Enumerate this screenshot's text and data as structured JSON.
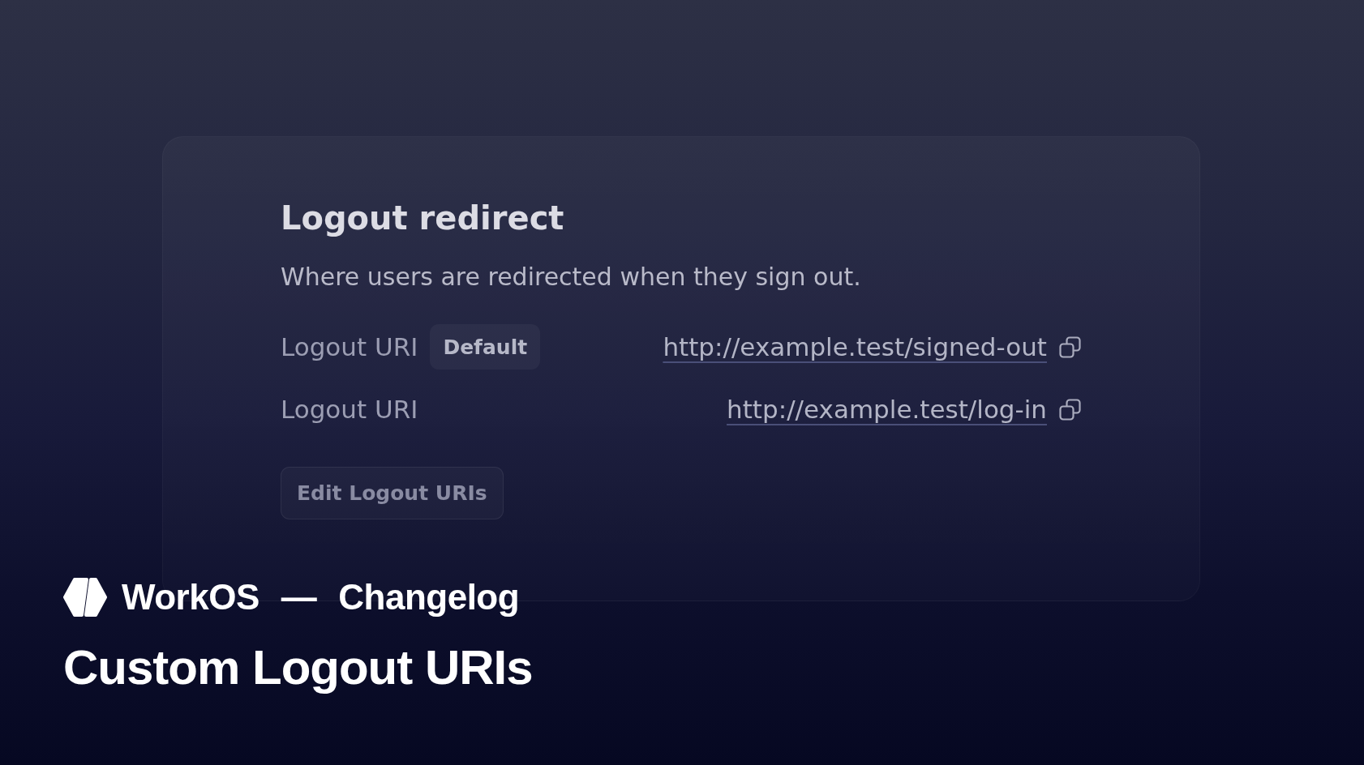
{
  "card": {
    "title": "Logout redirect",
    "description": "Where users are redirected when they sign out.",
    "uris": [
      {
        "label": "Logout URI",
        "badge": "Default",
        "url": "http://example.test/signed-out"
      },
      {
        "label": "Logout URI",
        "url": "http://example.test/log-in"
      }
    ],
    "button": "Edit Logout URIs"
  },
  "footer": {
    "brand": "WorkOS",
    "separator": "—",
    "section": "Changelog",
    "headline": "Custom Logout URIs"
  }
}
